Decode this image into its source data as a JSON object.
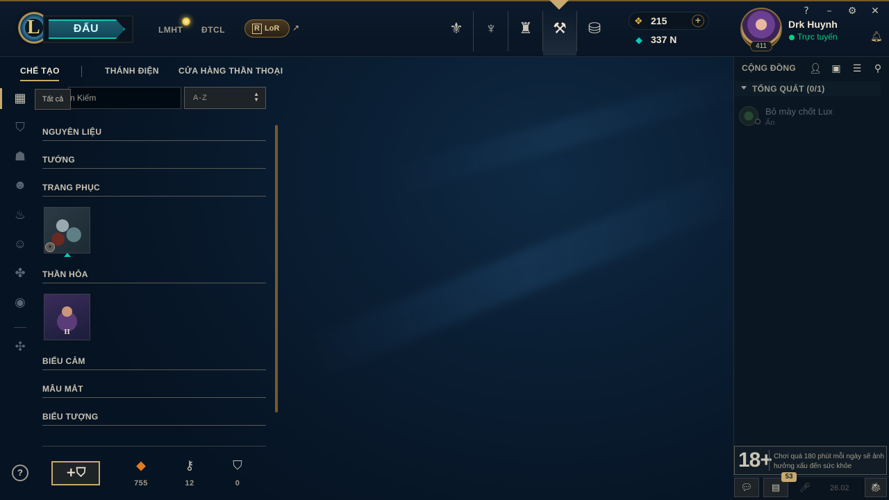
{
  "header": {
    "play_label": "ĐẤU",
    "nav_links": [
      "LMHT",
      "ĐTCL"
    ],
    "lor_label": "LoR",
    "lor_mark": "R",
    "external_arrow": "↗",
    "top_icons": [
      {
        "name": "home-trophy-icon",
        "glyph": "⚜"
      },
      {
        "name": "profile-icon",
        "glyph": "♆"
      },
      {
        "name": "collection-icon",
        "glyph": "♜"
      },
      {
        "name": "loot-icon",
        "glyph": "⚒"
      },
      {
        "name": "store-icon",
        "glyph": "⛁"
      }
    ],
    "rp_value": "215",
    "rp_plus": "+",
    "be_value": "337 N",
    "summoner_name": "Drk Huynh",
    "status": "Trực tuyến",
    "level": "411",
    "window_controls": [
      "?",
      "–",
      "⚙",
      "✕"
    ]
  },
  "subnav": {
    "items": [
      "CHẾ TẠO",
      "THÁNH ĐIỆN",
      "CỬA HÀNG THẦN THOẠI"
    ]
  },
  "sidebar": {
    "tooltip": "Tất cả",
    "icons": [
      {
        "name": "all-grid-icon",
        "glyph": "▦"
      },
      {
        "name": "chest-icon",
        "glyph": "⛉"
      },
      {
        "name": "champion-helmet-icon",
        "glyph": "☗"
      },
      {
        "name": "skin-mask-icon",
        "glyph": "☻"
      },
      {
        "name": "ward-icon",
        "glyph": "♨"
      },
      {
        "name": "emote-icon",
        "glyph": "☺"
      },
      {
        "name": "eternals-icon",
        "glyph": "✤"
      },
      {
        "name": "summoner-icon",
        "glyph": "◉"
      },
      {
        "name": "tft-icon",
        "glyph": "✣"
      }
    ]
  },
  "filters": {
    "search_value": "Tìm Kiếm",
    "search_visible": "n Kiếm",
    "sort_value": "A-Z"
  },
  "categories": [
    "NGUYÊN LIỆU",
    "TƯỚNG",
    "TRANG PHỤC",
    "THẦN HỎA",
    "BIỂU CẢM",
    "MẪU MẮT",
    "BIỂU TƯỢNG"
  ],
  "tiles": {
    "emote_roman": "II"
  },
  "bottom": {
    "help": "?",
    "add_chest": "+⛉",
    "resources": [
      {
        "name": "orange-essence-icon",
        "glyph": "◆",
        "color": "#e07b24",
        "value": "755"
      },
      {
        "name": "key-icon",
        "glyph": "⚷",
        "color": "#c8c3b4",
        "value": "12"
      },
      {
        "name": "chest-count-icon",
        "glyph": "⛉",
        "color": "#c8c3b4",
        "value": "0"
      }
    ]
  },
  "social": {
    "title": "CỘNG ĐỒNG",
    "group_title": "TỔNG QUÁT (0/1)",
    "friend_name": "Bỏ mày chốt Lux",
    "friend_status": "Ẩn",
    "age_rating": "18+",
    "age_warning": "Chơi quá 180 phút mỗi ngày sẽ ảnh hưởng xấu đến sức khỏe",
    "message_count": "53",
    "version": "26.02"
  },
  "colors": {
    "gold": "#c8aa6e",
    "teal": "#0ac8b9",
    "online": "#0acd7f"
  }
}
